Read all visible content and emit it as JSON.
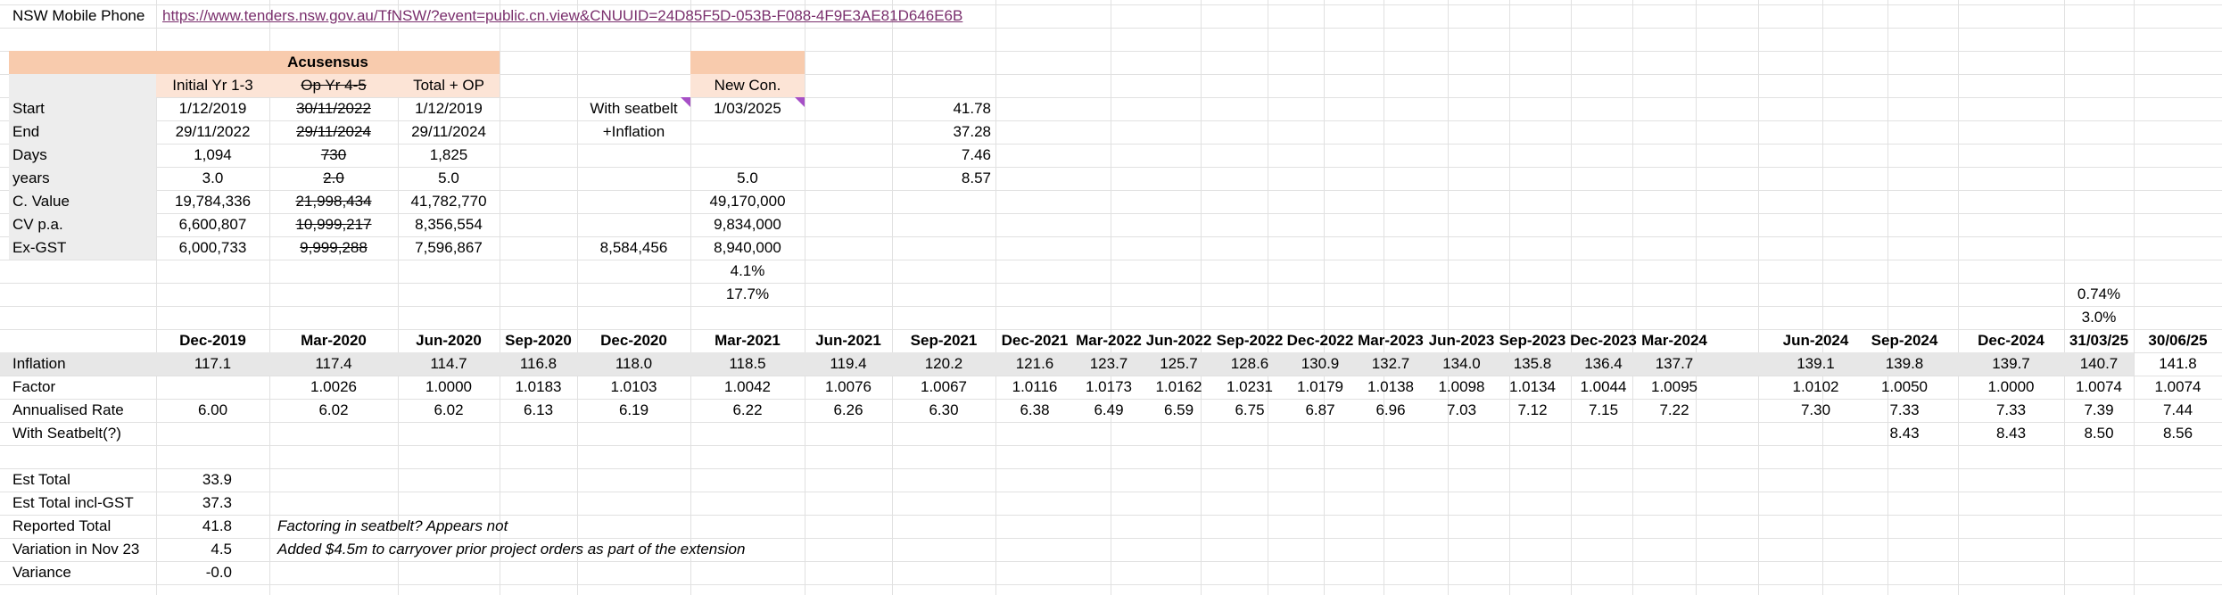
{
  "header": {
    "title": "NSW Mobile Phone",
    "link": "https://www.tenders.nsw.gov.au/TfNSW/?event=public.cn.view&CNUUID=24D85F5D-053B-F088-4F9E3AE81D646E6B"
  },
  "colors": {
    "header_band": "#f8cbad",
    "subheader_band": "#fce4d6",
    "label_band": "#ededed",
    "inflation_band": "#e7e7e7",
    "comment_marker": "#a64fc6",
    "link": "#7a2f6d"
  },
  "contract": {
    "group_title": "Acusensus",
    "col_headers": [
      "Initial Yr 1-3",
      "Op Yr 4-5",
      "Total + OP"
    ],
    "new_con_header": "New Con.",
    "rows": [
      {
        "label": "Start",
        "initial": "1/12/2019",
        "op": "30/11/2022",
        "total": "1/12/2019",
        "note": "With seatbelt",
        "new_con": "1/03/2025",
        "extra": "41.78"
      },
      {
        "label": "End",
        "initial": "29/11/2022",
        "op": "29/11/2024",
        "total": "29/11/2024",
        "note": "+Inflation",
        "new_con": "",
        "extra": "37.28"
      },
      {
        "label": "Days",
        "initial": "1,094",
        "op": "730",
        "total": "1,825",
        "note": "",
        "new_con": "",
        "extra": "7.46"
      },
      {
        "label": "years",
        "initial": "3.0",
        "op": "2.0",
        "total": "5.0",
        "note": "",
        "new_con": "5.0",
        "extra": "8.57"
      },
      {
        "label": "C. Value",
        "initial": "19,784,336",
        "op": "21,998,434",
        "total": "41,782,770",
        "note": "",
        "new_con": "49,170,000",
        "extra": ""
      },
      {
        "label": "CV p.a.",
        "initial": "6,600,807",
        "op": "10,999,217",
        "total": "8,356,554",
        "note": "",
        "new_con": "9,834,000",
        "extra": ""
      },
      {
        "label": "Ex-GST",
        "initial": "6,000,733",
        "op": "9,999,288",
        "total": "7,596,867",
        "note": "8,584,456",
        "new_con": "8,940,000",
        "extra": ""
      }
    ],
    "pct1": "4.1%",
    "pct2": "17.7%"
  },
  "rate_pcts": [
    "0.74%",
    "3.0%"
  ],
  "timeline": {
    "periods": [
      "Dec-2019",
      "Mar-2020",
      "Jun-2020",
      "Sep-2020",
      "Dec-2020",
      "Mar-2021",
      "Jun-2021",
      "Sep-2021",
      "Dec-2021",
      "Mar-2022",
      "Jun-2022",
      "Sep-2022",
      "Dec-2022",
      "Mar-2023",
      "Jun-2023",
      "Sep-2023",
      "Dec-2023",
      "Mar-2024",
      "Jun-2024",
      "Sep-2024",
      "Dec-2024",
      "31/03/25",
      "30/06/25"
    ],
    "inflation_label": "Inflation",
    "inflation": [
      "117.1",
      "117.4",
      "114.7",
      "116.8",
      "118.0",
      "118.5",
      "119.4",
      "120.2",
      "121.6",
      "123.7",
      "125.7",
      "128.6",
      "130.9",
      "132.7",
      "134.0",
      "135.8",
      "136.4",
      "137.7",
      "139.1",
      "139.8",
      "139.7",
      "140.7",
      "141.8"
    ],
    "factor_label": "Factor",
    "factor": [
      "",
      "1.0026",
      "1.0000",
      "1.0183",
      "1.0103",
      "1.0042",
      "1.0076",
      "1.0067",
      "1.0116",
      "1.0173",
      "1.0162",
      "1.0231",
      "1.0179",
      "1.0138",
      "1.0098",
      "1.0134",
      "1.0044",
      "1.0095",
      "1.0102",
      "1.0050",
      "1.0000",
      "1.0074",
      "1.0074"
    ],
    "rate_label": "Annualised Rate",
    "rate": [
      "6.00",
      "6.02",
      "6.02",
      "6.13",
      "6.19",
      "6.22",
      "6.26",
      "6.30",
      "6.38",
      "6.49",
      "6.59",
      "6.75",
      "6.87",
      "6.96",
      "7.03",
      "7.12",
      "7.15",
      "7.22",
      "7.30",
      "7.33",
      "7.33",
      "7.39",
      "7.44"
    ],
    "seatbelt_label": "With Seatbelt(?)",
    "seatbelt": [
      "",
      "",
      "",
      "",
      "",
      "",
      "",
      "",
      "",
      "",
      "",
      "",
      "",
      "",
      "",
      "",
      "",
      "",
      "",
      "8.43",
      "8.43",
      "8.50",
      "8.56"
    ]
  },
  "summary": [
    {
      "label": "Est Total",
      "value": "33.9",
      "note": ""
    },
    {
      "label": "Est Total incl-GST",
      "value": "37.3",
      "note": ""
    },
    {
      "label": "Reported Total",
      "value": "41.8",
      "note": "Factoring in seatbelt? Appears not"
    },
    {
      "label": "Variation in Nov 23",
      "value": "4.5",
      "note": "Added $4.5m to carryover prior project orders as part of the extension"
    },
    {
      "label": "Variance",
      "value": "-0.0",
      "note": ""
    }
  ]
}
